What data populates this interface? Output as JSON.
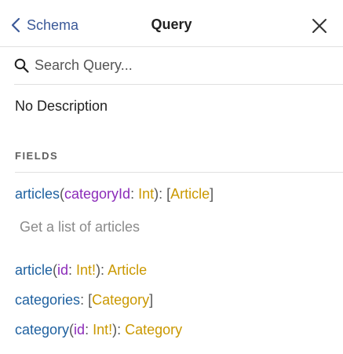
{
  "header": {
    "back_label": "Schema",
    "title": "Query"
  },
  "search": {
    "placeholder": "Search Query...",
    "value": ""
  },
  "description": "No Description",
  "fields_section": {
    "title": "FIELDS",
    "fields": [
      {
        "name": "articles",
        "args": [
          {
            "name": "categoryId",
            "type": "Int"
          }
        ],
        "type": "Article",
        "list": true,
        "description": "Get a list of articles"
      },
      {
        "name": "article",
        "args": [
          {
            "name": "id",
            "type": "Int!"
          }
        ],
        "type": "Article",
        "list": false,
        "description": ""
      },
      {
        "name": "categories",
        "args": [],
        "type": "Category",
        "list": true,
        "description": ""
      },
      {
        "name": "category",
        "args": [
          {
            "name": "id",
            "type": "Int!"
          }
        ],
        "type": "Category",
        "list": false,
        "description": ""
      }
    ]
  },
  "colors": {
    "field_name": "#1f61a0",
    "arg_name": "#8b2bb9",
    "type_name": "#ca9800",
    "link": "#3b5998"
  }
}
